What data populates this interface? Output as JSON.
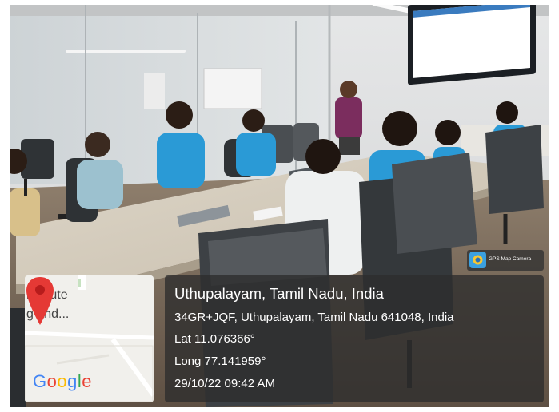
{
  "location": {
    "title": "Uthupalayam, Tamil Nadu, India",
    "address": "34GR+JQF, Uthupalayam, Tamil Nadu 641048, India",
    "latitude": "Lat 11.076366°",
    "longitude": "Long 77.141959°",
    "timestamp": "29/10/22 09:42 AM"
  },
  "map": {
    "label_line1": "nstitute",
    "label_line2": "g and...",
    "provider": "Google",
    "pin_color": "#e53935",
    "pin_icon": "map-pin-icon"
  },
  "badge": {
    "label": "GPS Map Camera",
    "icon": "gps-map-camera-icon"
  },
  "colors": {
    "panel_background": "#2d2d2d",
    "shirt_blue": "#2a9ad6",
    "shirt_purple": "#7b2d5e"
  }
}
